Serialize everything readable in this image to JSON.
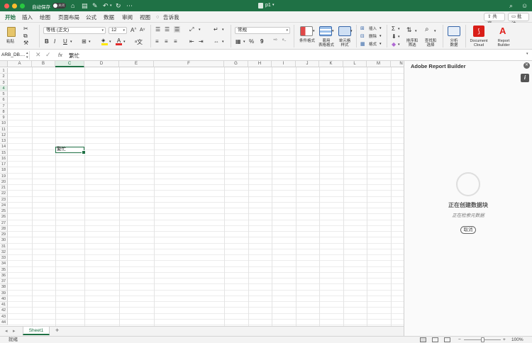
{
  "titlebar": {
    "autosave_label": "自动保存",
    "autosave_state": "关闭",
    "document_title": "p1",
    "title_icon": "excel-icon"
  },
  "menubar": {
    "tabs": [
      "开始",
      "插入",
      "绘图",
      "页面布局",
      "公式",
      "数据",
      "审阅",
      "视图"
    ],
    "active_tab": "开始",
    "tell_me": "告诉我",
    "share_label": "共享",
    "comment_label": "批注"
  },
  "ribbon": {
    "paste_label": "粘贴",
    "font_name": "等线 (正文)",
    "font_size": "12",
    "number_format": "常规",
    "conditional_format": "条件格式",
    "table_format": "套用\n表格格式",
    "cell_styles": "单元格\n样式",
    "insert": "插入",
    "delete": "删除",
    "format": "格式",
    "sort_filter": "排序和\n筛选",
    "find_select": "查找和\n选择",
    "analyze": "分析\n数据",
    "document_cloud": "Document\nCloud",
    "report_builder": "Report\nBuilder",
    "bold": "B",
    "italic": "I",
    "underline": "U",
    "increase_font": "A",
    "decrease_font": "A",
    "percent": "%",
    "comma": "9"
  },
  "formula": {
    "name_box": "ARB_DB....",
    "fx": "fx",
    "content": "繁忙"
  },
  "sheet": {
    "columns": [
      "A",
      "B",
      "C",
      "D",
      "E",
      "F",
      "G",
      "H",
      "I",
      "J",
      "K",
      "L",
      "M",
      "N"
    ],
    "rows": [
      "1",
      "2",
      "3",
      "4",
      "5",
      "6",
      "7",
      "8",
      "9",
      "10",
      "11",
      "12",
      "13",
      "14",
      "15",
      "16",
      "17",
      "18",
      "19",
      "20",
      "21",
      "22",
      "23",
      "24",
      "25",
      "26",
      "27",
      "28",
      "29",
      "30",
      "31",
      "32",
      "33",
      "34",
      "35",
      "36",
      "37",
      "38",
      "39",
      "40",
      "41",
      "42",
      "43",
      "44"
    ],
    "selected_cell": "C4",
    "selected_cell_value": "繁忙",
    "tab_name": "Sheet1",
    "add_sheet": "+"
  },
  "status": {
    "ready": "就绪",
    "zoom": "100%",
    "zoom_minus": "−",
    "zoom_plus": "+"
  },
  "pane": {
    "title": "Adobe Report Builder",
    "info": "i",
    "status_title": "正在创建数据块",
    "status_subtitle": "正在检索元数据",
    "cancel_label": "取消"
  },
  "colors": {
    "accent": "#1f7145",
    "ribbon_bg": "#f3f3f3"
  }
}
